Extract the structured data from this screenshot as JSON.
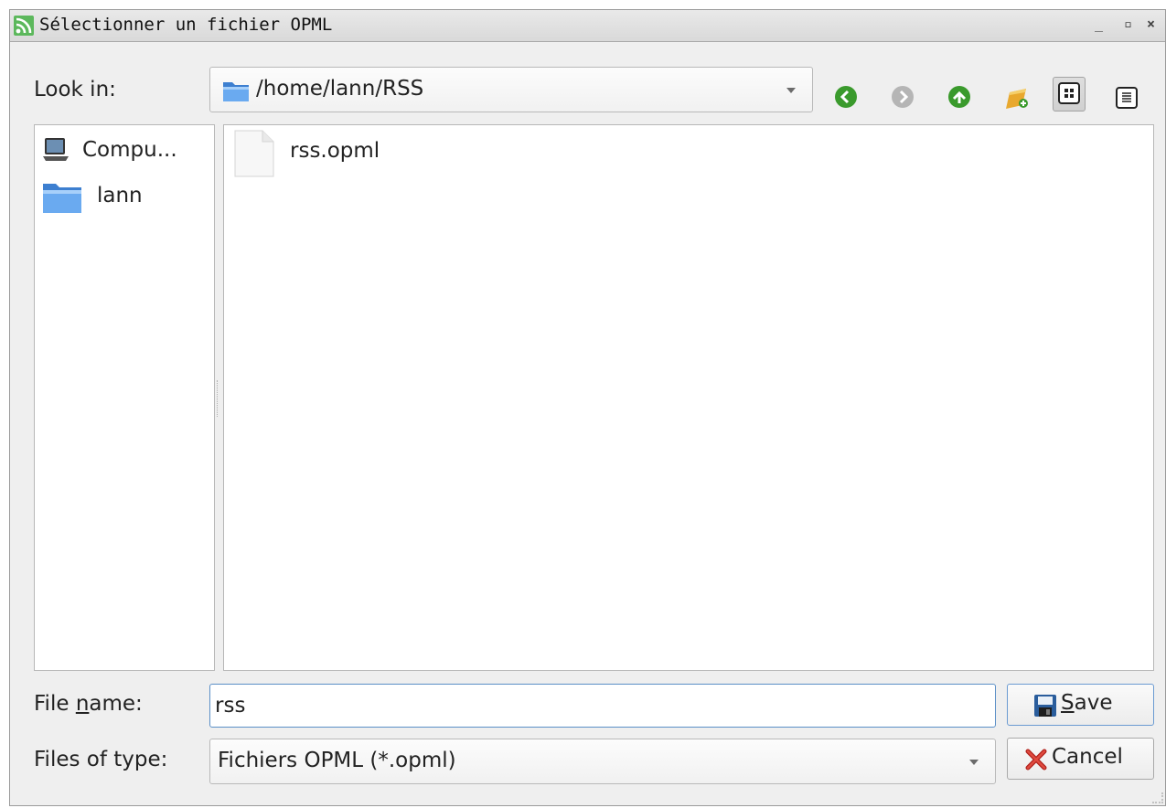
{
  "window": {
    "title": "Sélectionner un fichier OPML",
    "controls": {
      "minimize": "_",
      "restore": "▫",
      "close": "×"
    }
  },
  "toolbar": {
    "look_in_label": "Look in:",
    "path": "/home/lann/RSS",
    "icons": [
      "back-icon",
      "forward-icon",
      "parent-dir-icon",
      "new-folder-icon",
      "icon-view-icon",
      "detail-view-icon"
    ],
    "active_view": "icon-view"
  },
  "sidebar": {
    "items": [
      {
        "label": "Compu...",
        "icon": "computer-icon"
      },
      {
        "label": "lann",
        "icon": "folder-icon"
      }
    ]
  },
  "files": {
    "items": [
      {
        "label": "rss.opml",
        "icon": "document-icon"
      }
    ]
  },
  "footer": {
    "file_name_prefix": "File ",
    "file_name_rest": "name:",
    "file_name_value": "rss",
    "files_of_type_label": "Files of type:",
    "files_of_type_value": "Fichiers OPML (*.opml)",
    "save_label": "Save",
    "cancel_label": "Cancel"
  },
  "colors": {
    "accent_focus": "#5b8fc7",
    "folder_blue": "#4a90d9",
    "nav_green": "#3a9a2c",
    "rss_green": "#5cb85c"
  }
}
